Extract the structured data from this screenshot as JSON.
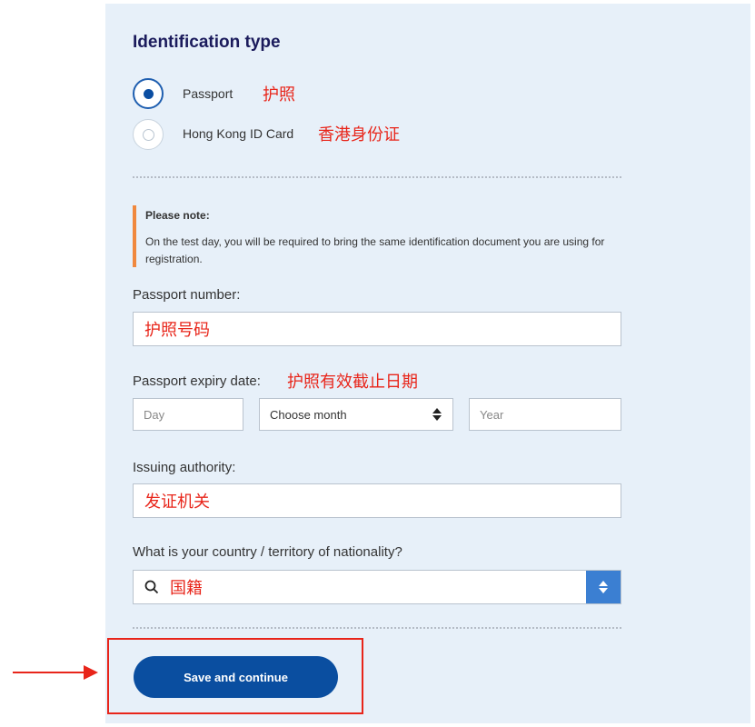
{
  "identification": {
    "title": "Identification type",
    "options": [
      {
        "label": "Passport",
        "annotation": "护照",
        "selected": true
      },
      {
        "label": "Hong Kong ID Card",
        "annotation": "香港身份证",
        "selected": false
      }
    ]
  },
  "note": {
    "title": "Please note:",
    "text": "On the test day, you will be required to bring the same identification document you are using for registration."
  },
  "passport_number": {
    "label": "Passport number:",
    "value": "护照号码"
  },
  "expiry": {
    "label": "Passport expiry date:",
    "annotation": "护照有效截止日期",
    "day_placeholder": "Day",
    "month_value": "Choose month",
    "year_placeholder": "Year"
  },
  "issuing": {
    "label": "Issuing authority:",
    "value": "发证机关"
  },
  "nationality": {
    "label": "What is your country / territory of nationality?",
    "value": "国籍"
  },
  "save_button": {
    "label": "Save and continue"
  },
  "colors": {
    "primary": "#0a4ea0",
    "annotation_red": "#e8251a",
    "note_accent": "#f0883e",
    "panel_bg": "#e7f0f9"
  },
  "icons": [
    "search-icon",
    "sort-arrows-icon",
    "arrow-right-icon"
  ]
}
